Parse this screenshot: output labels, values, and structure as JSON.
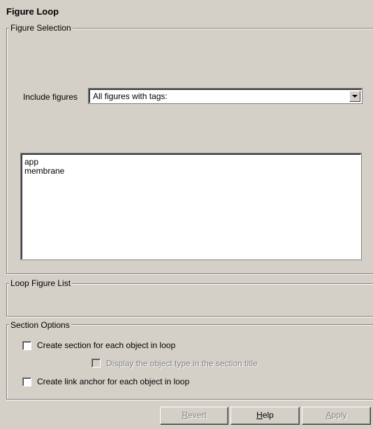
{
  "title": "Figure Loop",
  "figure_selection": {
    "legend": "Figure Selection",
    "include_label": "Include figures",
    "include_value": "All figures with tags:",
    "tags": [
      "app",
      "membrane"
    ]
  },
  "loop_figure_list": {
    "legend": "Loop Figure List"
  },
  "section_options": {
    "legend": "Section Options",
    "create_section_label": "Create section for each object in loop",
    "create_section_checked": false,
    "display_type_label": "Display the object type in the section title",
    "display_type_checked": false,
    "display_type_enabled": false,
    "link_anchor_label": "Create link anchor for each object in loop",
    "link_anchor_checked": false
  },
  "buttons": {
    "revert": {
      "mnemonic": "R",
      "rest": "evert",
      "enabled": false
    },
    "help": {
      "mnemonic": "H",
      "rest": "elp",
      "enabled": true
    },
    "apply": {
      "mnemonic": "A",
      "rest": "pply",
      "enabled": false
    }
  }
}
